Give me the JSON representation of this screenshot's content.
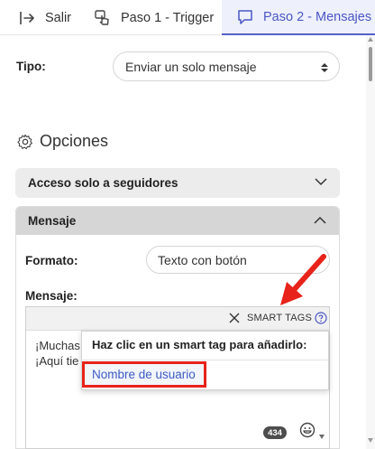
{
  "tabs": [
    {
      "label": "Salir",
      "icon": "exit-arrow-icon"
    },
    {
      "label": "Paso 1 - Trigger",
      "icon": "pointer-hand-icon"
    },
    {
      "label": "Paso 2 - Mensajes",
      "icon": "chat-bubble-icon",
      "active": true
    }
  ],
  "tipo": {
    "label": "Tipo:",
    "value": "Enviar un solo mensaje"
  },
  "opciones": {
    "title": "Opciones"
  },
  "sections": {
    "seguidores": {
      "title": "Acceso solo a seguidores",
      "expanded": false
    },
    "mensaje": {
      "title": "Mensaje",
      "expanded": true
    }
  },
  "formato": {
    "label": "Formato:",
    "value": "Texto con botón"
  },
  "mensaje": {
    "label": "Mensaje:",
    "toolbar": {
      "smart_tags_label": "SMART TAGS"
    },
    "text_lines": [
      "¡Muchas",
      "¡Aquí tie"
    ],
    "char_count": "434"
  },
  "smart_tag_popup": {
    "title": "Haz clic en un smart tag para añadirlo:",
    "items": [
      "Nombre de usuario"
    ]
  },
  "colors": {
    "accent": "#5561c8",
    "active_tab_bg": "#eef0fb",
    "highlight_red": "#e8231a",
    "link_blue": "#3d5bc4"
  }
}
